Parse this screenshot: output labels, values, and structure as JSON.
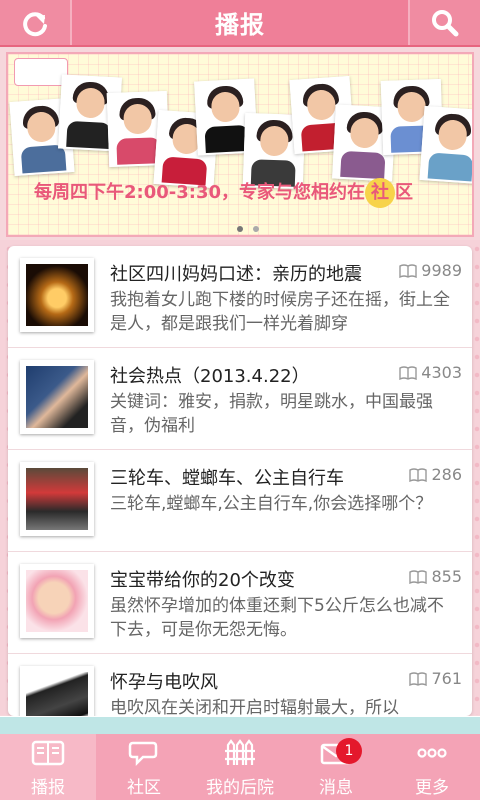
{
  "header": {
    "title": "播报",
    "left_icon": "refresh-icon",
    "right_icon": "search-icon"
  },
  "banner": {
    "caption_part1": "每周四下午2:00-3:30，专家与您相约在",
    "caption_highlight": "社",
    "caption_part2": "区",
    "page_dots": 2
  },
  "feed": [
    {
      "title": "社区四川妈妈口述：亲历的地震",
      "count": "9989",
      "desc": "我抱着女儿跑下楼的时候房子还在摇，街上全是人，都是跟我们一样光着脚穿"
    },
    {
      "title": "社会热点（2013.4.22）",
      "count": "4303",
      "desc": "关键词：雅安，捐款，明星跳水，中国最强音，伪福利"
    },
    {
      "title": "三轮车、螳螂车、公主自行车",
      "count": "286",
      "desc": "三轮车,螳螂车,公主自行车,你会选择哪个？"
    },
    {
      "title": "宝宝带给你的20个改变",
      "count": "855",
      "desc": "虽然怀孕增加的体重还剩下5公斤怎么也减不下去，可是你无怨无悔。"
    },
    {
      "title": "怀孕与电吹风",
      "count": "761",
      "desc": "电吹风在关闭和开启时辐射最大，所以"
    }
  ],
  "tabs": [
    {
      "label": "播报",
      "icon": "book-icon",
      "active": true
    },
    {
      "label": "社区",
      "icon": "chat-icon",
      "active": false
    },
    {
      "label": "我的后院",
      "icon": "fence-icon",
      "active": false
    },
    {
      "label": "消息",
      "icon": "envelope-icon",
      "active": false,
      "badge": "1"
    },
    {
      "label": "更多",
      "icon": "more-icon",
      "active": false
    }
  ],
  "colors": {
    "header_bg": "#ef7f98",
    "accent": "#e9587a",
    "badge": "#e4182c"
  }
}
